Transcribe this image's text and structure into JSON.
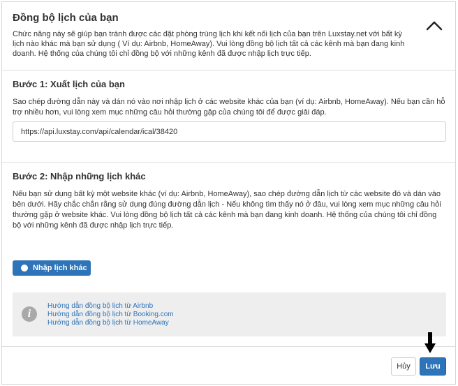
{
  "header": {
    "title": "Đồng bộ lịch của bạn",
    "intro": "Chức năng này sẽ giúp bạn tránh được các đặt phòng trùng lịch khi kết nối lịch của bạn trên Luxstay.net với bất kỳ lịch nào khác mà bạn sử dụng ( Ví dụ: Airbnb, HomeAway). Vui lòng đồng bộ lịch tất cả các kênh mà bạn đang kinh doanh. Hệ thống của chúng tôi chỉ đồng bộ với những kênh đã được nhập lịch trực tiếp.",
    "collapse_icon": "chevron-up-icon"
  },
  "step1": {
    "title": "Bước 1: Xuất lịch của bạn",
    "description": "Sao chép đường dẫn này và dán nó vào nơi nhập lịch ở các website khác của bạn (ví dụ: Airbnb, HomeAway). Nếu bạn cần hỗ trợ nhiều hơn, vui lòng xem mục những câu hỏi thường gặp của chúng tôi để được giải đáp.",
    "export_url": "https://api.luxstay.com/api/calendar/ical/38420"
  },
  "step2": {
    "title": "Bước 2: Nhập những lịch khác",
    "description": "Nếu bạn sử dụng bất kỳ một website khác (ví dụ: Airbnb, HomeAway), sao chép đường dẫn lịch từ các website đó và dán vào bên dưới. Hãy chắc chắn rằng sử dụng đúng đường dẫn lịch - Nếu không tìm thấy nó ở đâu, vui lòng xem mục những câu hỏi thường gặp ở website khác. Vui lòng đồng bộ lịch tất cả các kênh mà bạn đang kinh doanh. Hệ thống của chúng tôi chỉ đồng bộ với những kênh đã được nhập lịch trực tiếp.",
    "import_button": "Nhập lịch khác"
  },
  "help": {
    "icon": "info-icon",
    "links": [
      "Hướng dẫn đồng bộ lịch từ Airbnb",
      "Hướng dẫn đồng bộ lịch từ Booking.com",
      "Hướng dẫn đồng bộ lịch từ HomeAway"
    ]
  },
  "footer": {
    "cancel_label": "Hủy",
    "save_label": "Lưu"
  },
  "colors": {
    "primary": "#2d74b9",
    "info_bg": "#eeeeee"
  }
}
